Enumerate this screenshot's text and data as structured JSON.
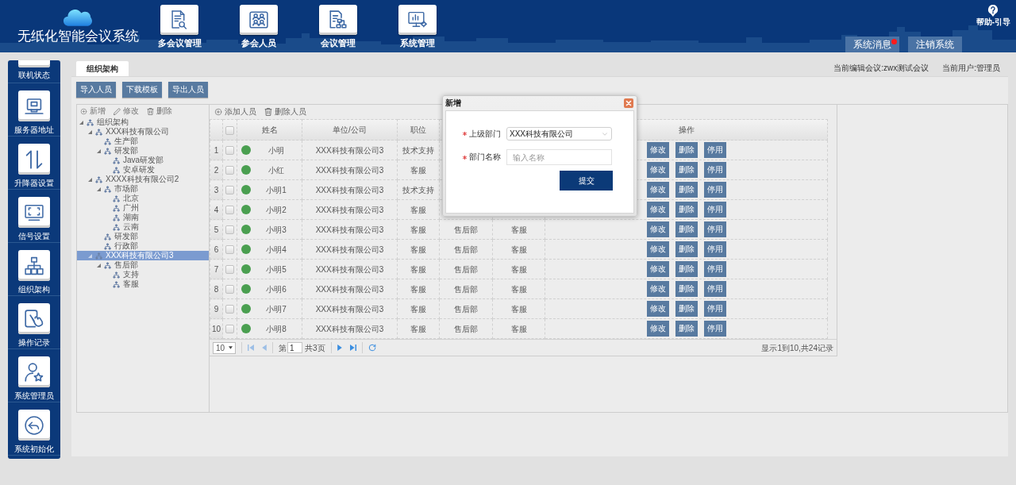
{
  "header": {
    "title": "无纸化智能会议系统",
    "nav": [
      "多会议管理",
      "参会人员",
      "会议管理",
      "系统管理"
    ],
    "help": "帮助-引导",
    "tabs": [
      {
        "label": "系统消息",
        "unread": true
      },
      {
        "label": "注销系统",
        "unread": false
      }
    ]
  },
  "sidebar": {
    "items": [
      "联机状态",
      "服务器地址",
      "升降器设置",
      "信号设置",
      "组织架构",
      "操作记录",
      "系统管理员",
      "系统初始化"
    ]
  },
  "tabs": [
    {
      "label": "组织架构",
      "selected": true
    }
  ],
  "status": {
    "meeting": "当前编辑会议:zwx测试会议",
    "user": "当前用户:管理员"
  },
  "buttons": [
    "导入人员",
    "下载模板",
    "导出人员"
  ],
  "tree": {
    "actions": [
      "新增",
      "修改",
      "删除"
    ],
    "nodes": [
      {
        "label": "组织架构",
        "expanded": true,
        "selected": false,
        "children": [
          {
            "label": "XXX科技有限公司",
            "expanded": true,
            "selected": false,
            "children": [
              {
                "label": "生产部",
                "selected": false
              },
              {
                "label": "研发部",
                "expanded": true,
                "selected": false,
                "children": [
                  {
                    "label": "Java研发部",
                    "selected": false
                  },
                  {
                    "label": "安卓研发",
                    "selected": false
                  }
                ]
              }
            ]
          },
          {
            "label": "XXXX科技有限公司2",
            "expanded": true,
            "selected": false,
            "children": [
              {
                "label": "市场部",
                "expanded": true,
                "selected": false,
                "children": [
                  {
                    "label": "北京",
                    "selected": false
                  },
                  {
                    "label": "广州",
                    "selected": false
                  },
                  {
                    "label": "湖南",
                    "selected": false
                  },
                  {
                    "label": "云南",
                    "selected": false
                  }
                ]
              },
              {
                "label": "研发部",
                "selected": false
              },
              {
                "label": "行政部",
                "selected": false
              }
            ]
          },
          {
            "label": "XXX科技有限公司3",
            "expanded": true,
            "selected": true,
            "children": [
              {
                "label": "售后部",
                "expanded": true,
                "selected": false,
                "children": [
                  {
                    "label": "支持",
                    "selected": false
                  },
                  {
                    "label": "客服",
                    "selected": false
                  }
                ]
              }
            ]
          }
        ]
      }
    ]
  },
  "table": {
    "actions": [
      "添加人员",
      "删除人员"
    ],
    "columns": [
      "姓名",
      "单位/公司",
      "职位",
      "操作"
    ],
    "header_checked": false,
    "rows": [
      {
        "number": "1",
        "checked": false,
        "online": true,
        "name": "小明",
        "company": "XXX科技有限公司3",
        "position": "技术支持",
        "buttons": [
          "修改",
          "删除",
          "停用"
        ]
      },
      {
        "number": "2",
        "checked": false,
        "online": true,
        "name": "小红",
        "company": "XXX科技有限公司3",
        "position": "客服",
        "buttons": [
          "修改",
          "删除",
          "停用"
        ]
      },
      {
        "number": "3",
        "checked": false,
        "online": true,
        "name": "小明1",
        "company": "XXX科技有限公司3",
        "position": "技术支持",
        "buttons": [
          "修改",
          "删除",
          "停用"
        ]
      },
      {
        "number": "4",
        "checked": false,
        "online": true,
        "name": "小明2",
        "company": "XXX科技有限公司3",
        "position": "客服",
        "buttons": [
          "修改",
          "删除",
          "停用"
        ]
      },
      {
        "number": "5",
        "checked": false,
        "online": true,
        "name": "小明3",
        "company": "XXX科技有限公司3",
        "position": "客服",
        "column_6": "售后部",
        "column_7": "客服",
        "buttons": [
          "修改",
          "删除",
          "停用"
        ]
      },
      {
        "number": "6",
        "checked": false,
        "online": true,
        "name": "小明4",
        "company": "XXX科技有限公司3",
        "position": "客服",
        "column_6": "售后部",
        "column_7": "客服",
        "buttons": [
          "修改",
          "删除",
          "停用"
        ]
      },
      {
        "number": "7",
        "checked": false,
        "online": true,
        "name": "小明5",
        "company": "XXX科技有限公司3",
        "position": "客服",
        "column_6": "售后部",
        "column_7": "客服",
        "buttons": [
          "修改",
          "删除",
          "停用"
        ]
      },
      {
        "number": "8",
        "checked": false,
        "online": true,
        "name": "小明6",
        "company": "XXX科技有限公司3",
        "position": "客服",
        "column_6": "售后部",
        "column_7": "客服",
        "buttons": [
          "修改",
          "删除",
          "停用"
        ]
      },
      {
        "number": "9",
        "checked": false,
        "online": true,
        "name": "小明7",
        "company": "XXX科技有限公司3",
        "position": "客服",
        "column_6": "售后部",
        "column_7": "客服",
        "buttons": [
          "修改",
          "删除",
          "停用"
        ]
      },
      {
        "number": "10",
        "checked": false,
        "online": true,
        "name": "小明8",
        "company": "XXX科技有限公司3",
        "position": "客服",
        "column_6": "售后部",
        "column_7": "客服",
        "buttons": [
          "修改",
          "删除",
          "停用"
        ]
      }
    ]
  },
  "pagination": {
    "page_size": "10",
    "page_label": "第",
    "page": "1",
    "total_pages": "共3页",
    "summary": "显示1到10,共24记录"
  },
  "dialog": {
    "title": "新增",
    "fields": [
      {
        "kind": "select",
        "label": "上级部门",
        "required": true,
        "value": "XXX科技有限公司"
      },
      {
        "kind": "input",
        "label": "部门名称",
        "required": true,
        "placeholder": "输入名称"
      }
    ],
    "submit": "提交"
  }
}
